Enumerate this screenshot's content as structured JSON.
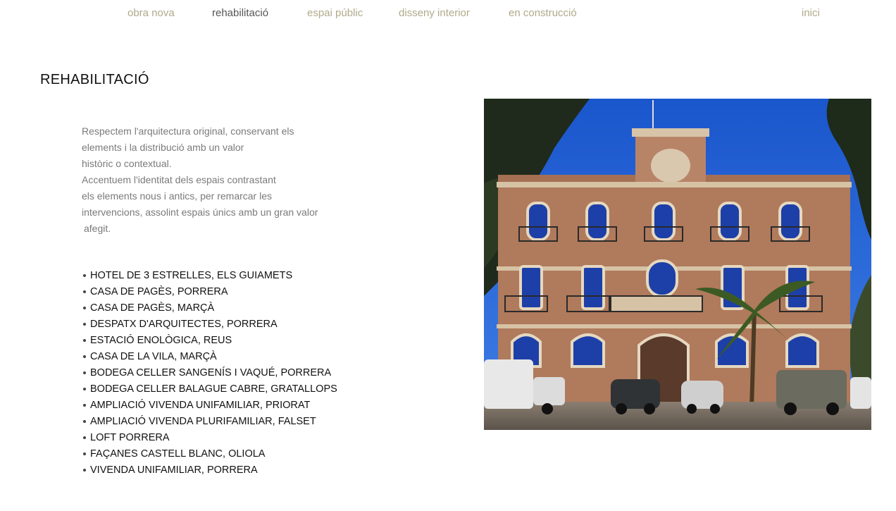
{
  "nav": {
    "obra_nova": "obra nova",
    "rehabilitacio": "rehabilitació",
    "espai_public": "espai públic",
    "disseny_interior": "disseny interior",
    "en_construccio": "en  construcció",
    "inici": "inici"
  },
  "page": {
    "title": "REHABILITACIÓ"
  },
  "intro_lines": [
    "Respectem l'arquitectura original, conservant els",
    "elements i la distribució amb un valor",
    "històric o contextual.",
    "Accentuem l'identitat dels espais contrastant",
    "els elements nous i antics, per remarcar les",
    "intervencions, assolint espais únics amb un gran valor",
    "afegit."
  ],
  "projects": [
    "HOTEL DE 3 ESTRELLES, ELS GUIAMETS",
    "CASA DE PAGÈS, PORRERA",
    "CASA DE PAGÈS, MARÇÀ",
    "DESPATX D'ARQUITECTES, PORRERA",
    "ESTACIÓ ENOLÒGICA, REUS",
    "CASA DE LA VILA, MARÇÀ",
    "BODEGA CELLER SANGENÍS I VAQUÉ, PORRERA",
    "BODEGA CELLER BALAGUE CABRE, GRATALLOPS",
    "AMPLIACIÓ VIVENDA UNIFAMILIAR, PRIORAT",
    "AMPLIACIÓ VIVENDA PLURIFAMILIAR, FALSET",
    "LOFT PORRERA",
    "FAÇANES CASTELL BLANC, OLIOLA",
    "VIVENDA UNIFAMILIAR, PORRERA"
  ],
  "colors": {
    "nav_link": "#b0a98a",
    "nav_active": "#555555",
    "intro_text": "#7a7a7a",
    "sky": "#1f5fd6",
    "brick": "#b07a5c"
  }
}
